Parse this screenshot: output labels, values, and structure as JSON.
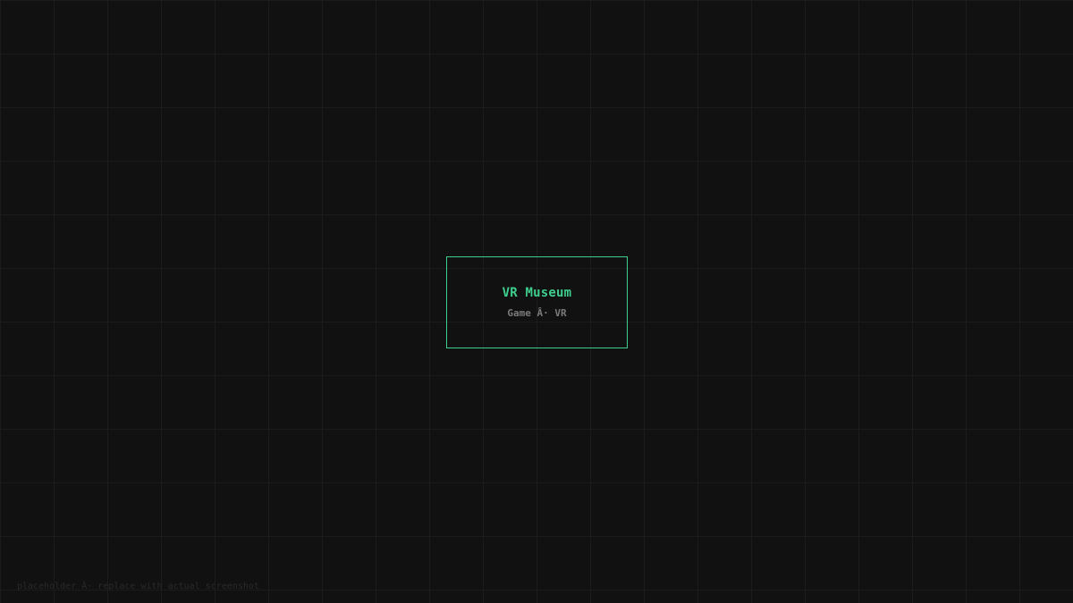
{
  "card": {
    "title": "VR Museum",
    "subtitle": "Game Â· VR"
  },
  "footer": {
    "note": "placeholder Â· replace with actual screenshot"
  },
  "colors": {
    "background": "#111111",
    "grid": "#1c1c1c",
    "accent": "#3ecf8e",
    "muted_text": "#7a7a7a"
  }
}
